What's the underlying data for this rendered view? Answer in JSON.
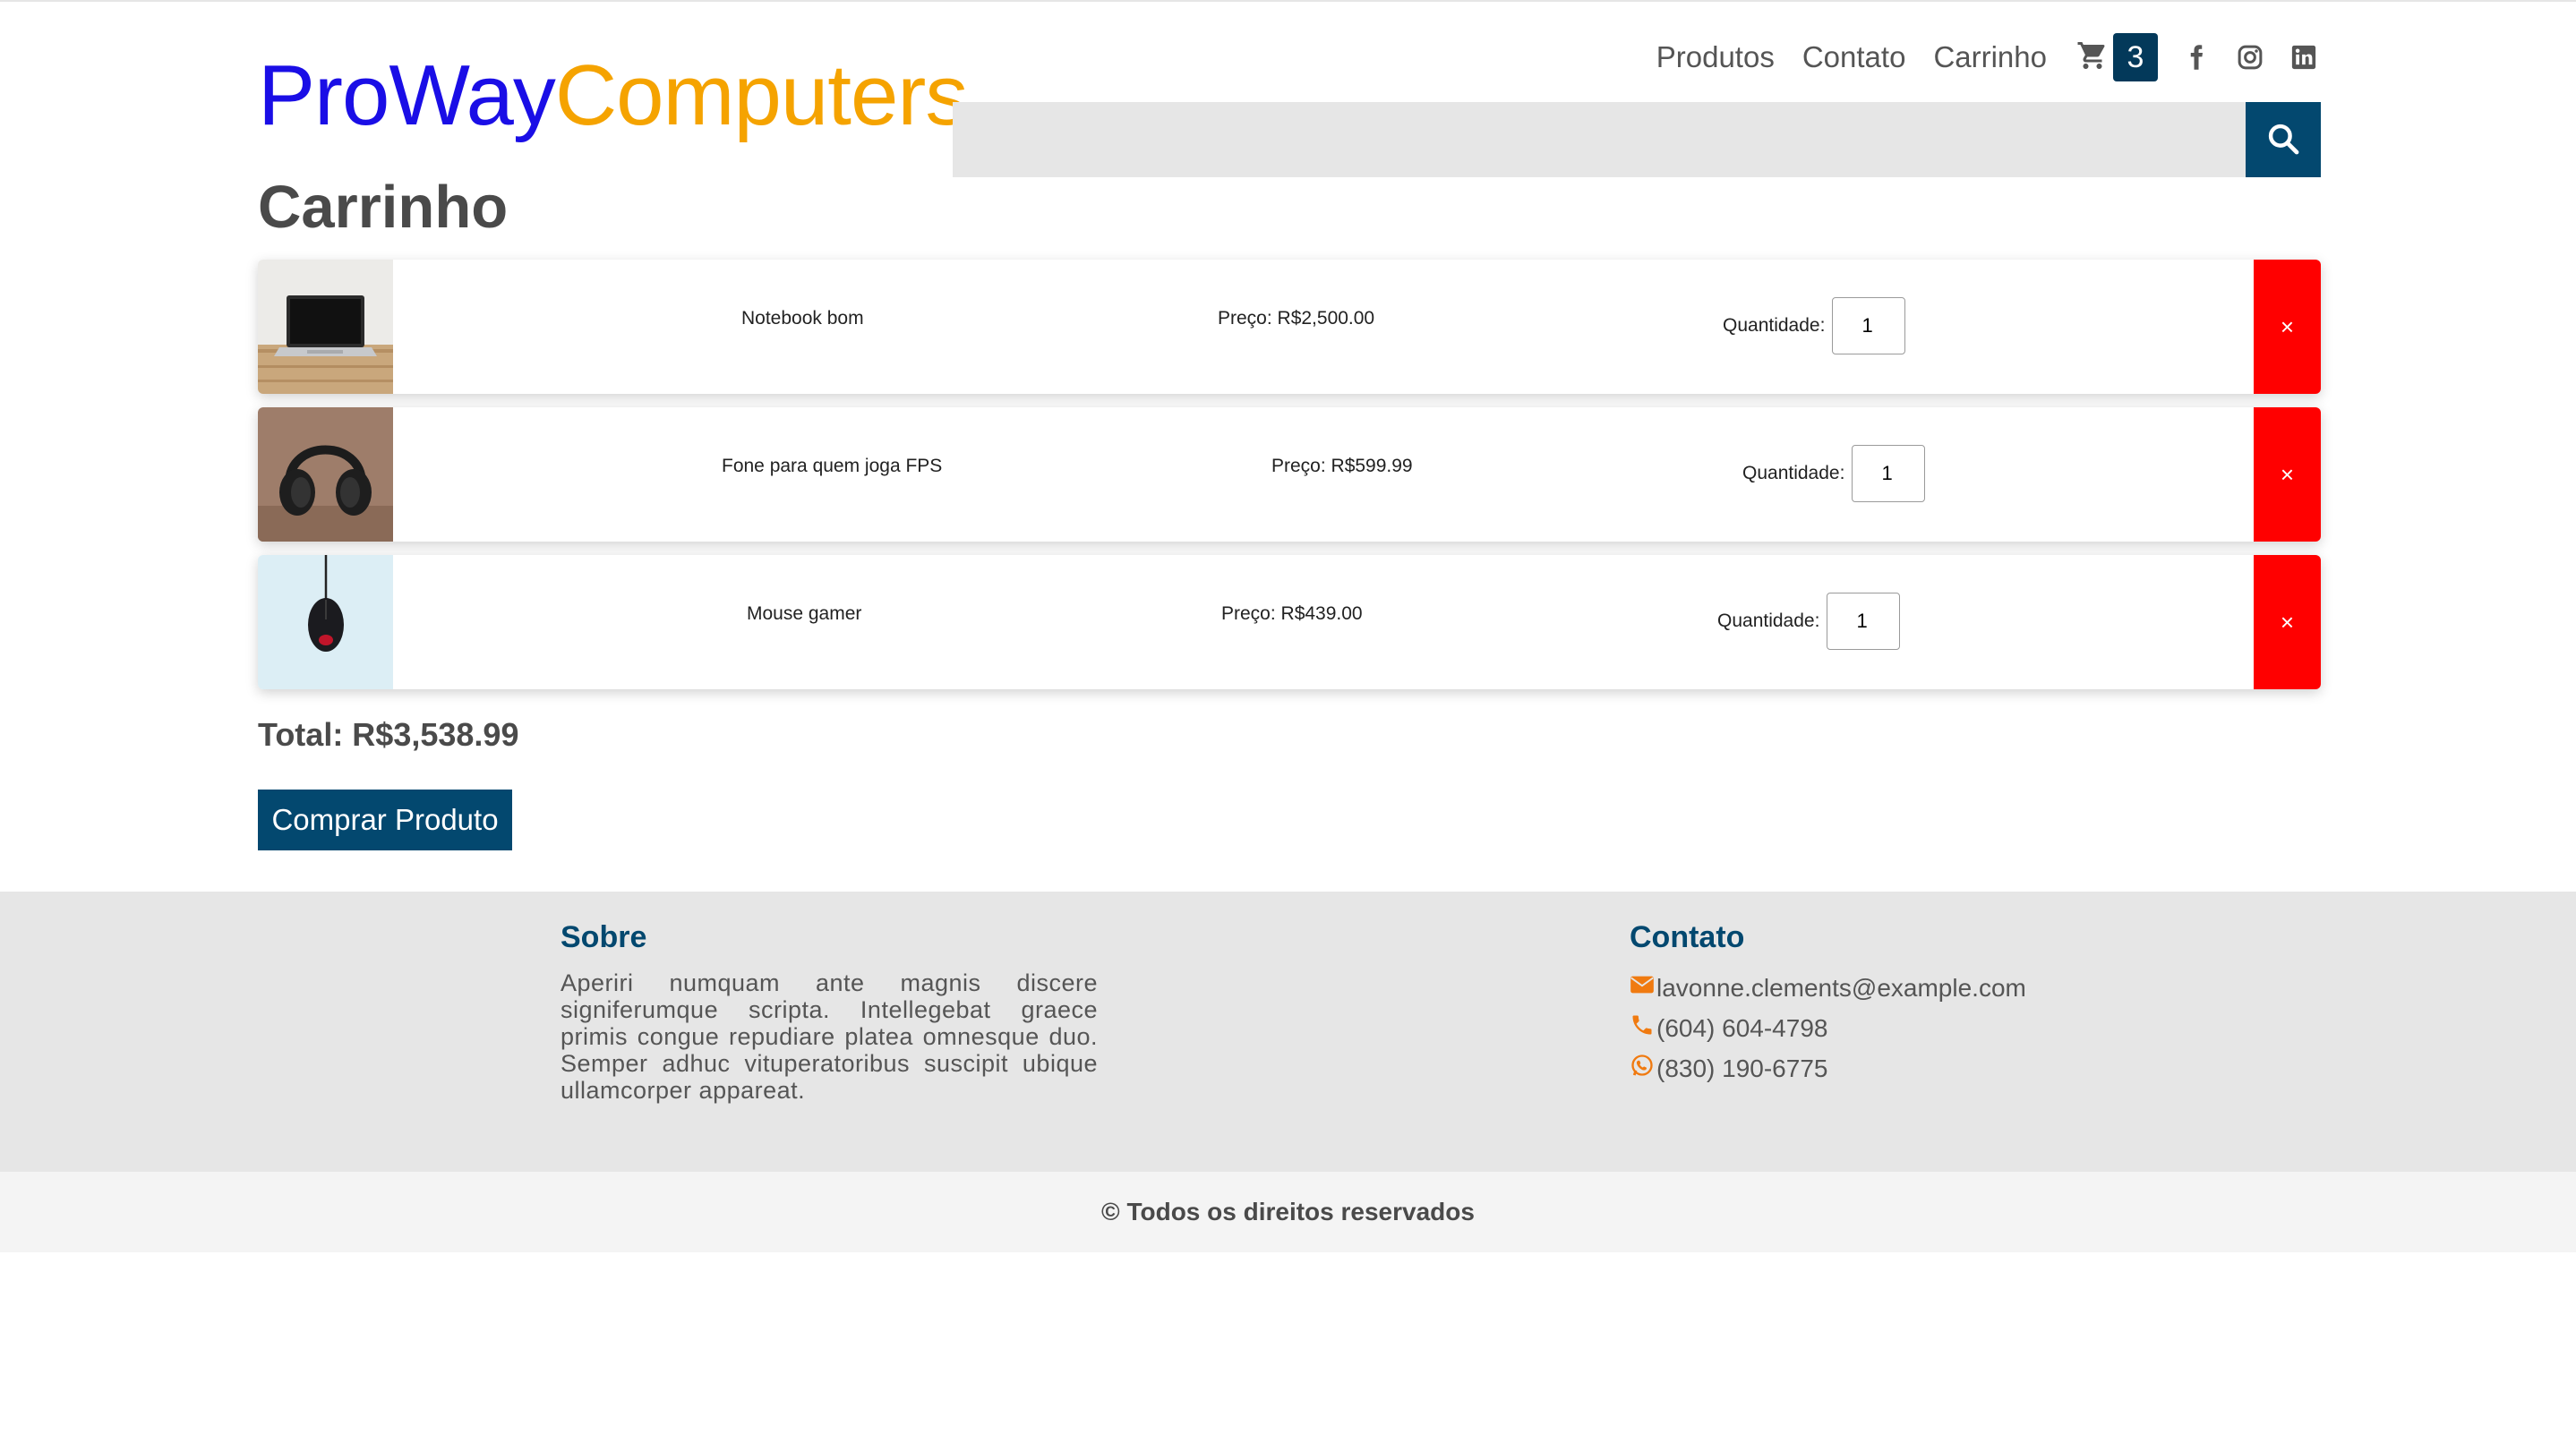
{
  "brand": {
    "part1": "ProWay",
    "part2": "Computers"
  },
  "nav": {
    "products": "Produtos",
    "contact": "Contato",
    "cart": "Carrinho",
    "cart_count": "3"
  },
  "social": [
    "facebook-icon",
    "instagram-icon",
    "linkedin-icon"
  ],
  "search": {
    "value": ""
  },
  "page_title": "Carrinho",
  "cart_items": [
    {
      "name": "Notebook bom",
      "price": "Preço: R$2,500.00",
      "qty_label": "Quantidade:",
      "qty": "1",
      "remove": "×"
    },
    {
      "name": "Fone para quem joga FPS",
      "price": "Preço: R$599.99",
      "qty_label": "Quantidade:",
      "qty": "1",
      "remove": "×"
    },
    {
      "name": "Mouse gamer",
      "price": "Preço: R$439.00",
      "qty_label": "Quantidade:",
      "qty": "1",
      "remove": "×"
    }
  ],
  "total": "Total: R$3,538.99",
  "buy_button": "Comprar Produto",
  "footer": {
    "about_title": "Sobre",
    "about_text": "Aperiri numquam ante magnis discere signiferumque scripta. Intellegebat graece primis congue repudiare platea omnesque duo. Semper adhuc vituperatoribus suscipit ubique ullamcorper appareat.",
    "contact_title": "Contato",
    "email": "lavonne.clements@example.com",
    "phone": "(604) 604-4798",
    "whatsapp": "(830) 190-6775",
    "copyright": "© Todos os direitos reservados"
  },
  "colors": {
    "brand_blue": "#1a0ee6",
    "brand_orange": "#f5a300",
    "primary": "#03486f",
    "danger": "#ff0000",
    "icon_orange": "#f07a10"
  }
}
